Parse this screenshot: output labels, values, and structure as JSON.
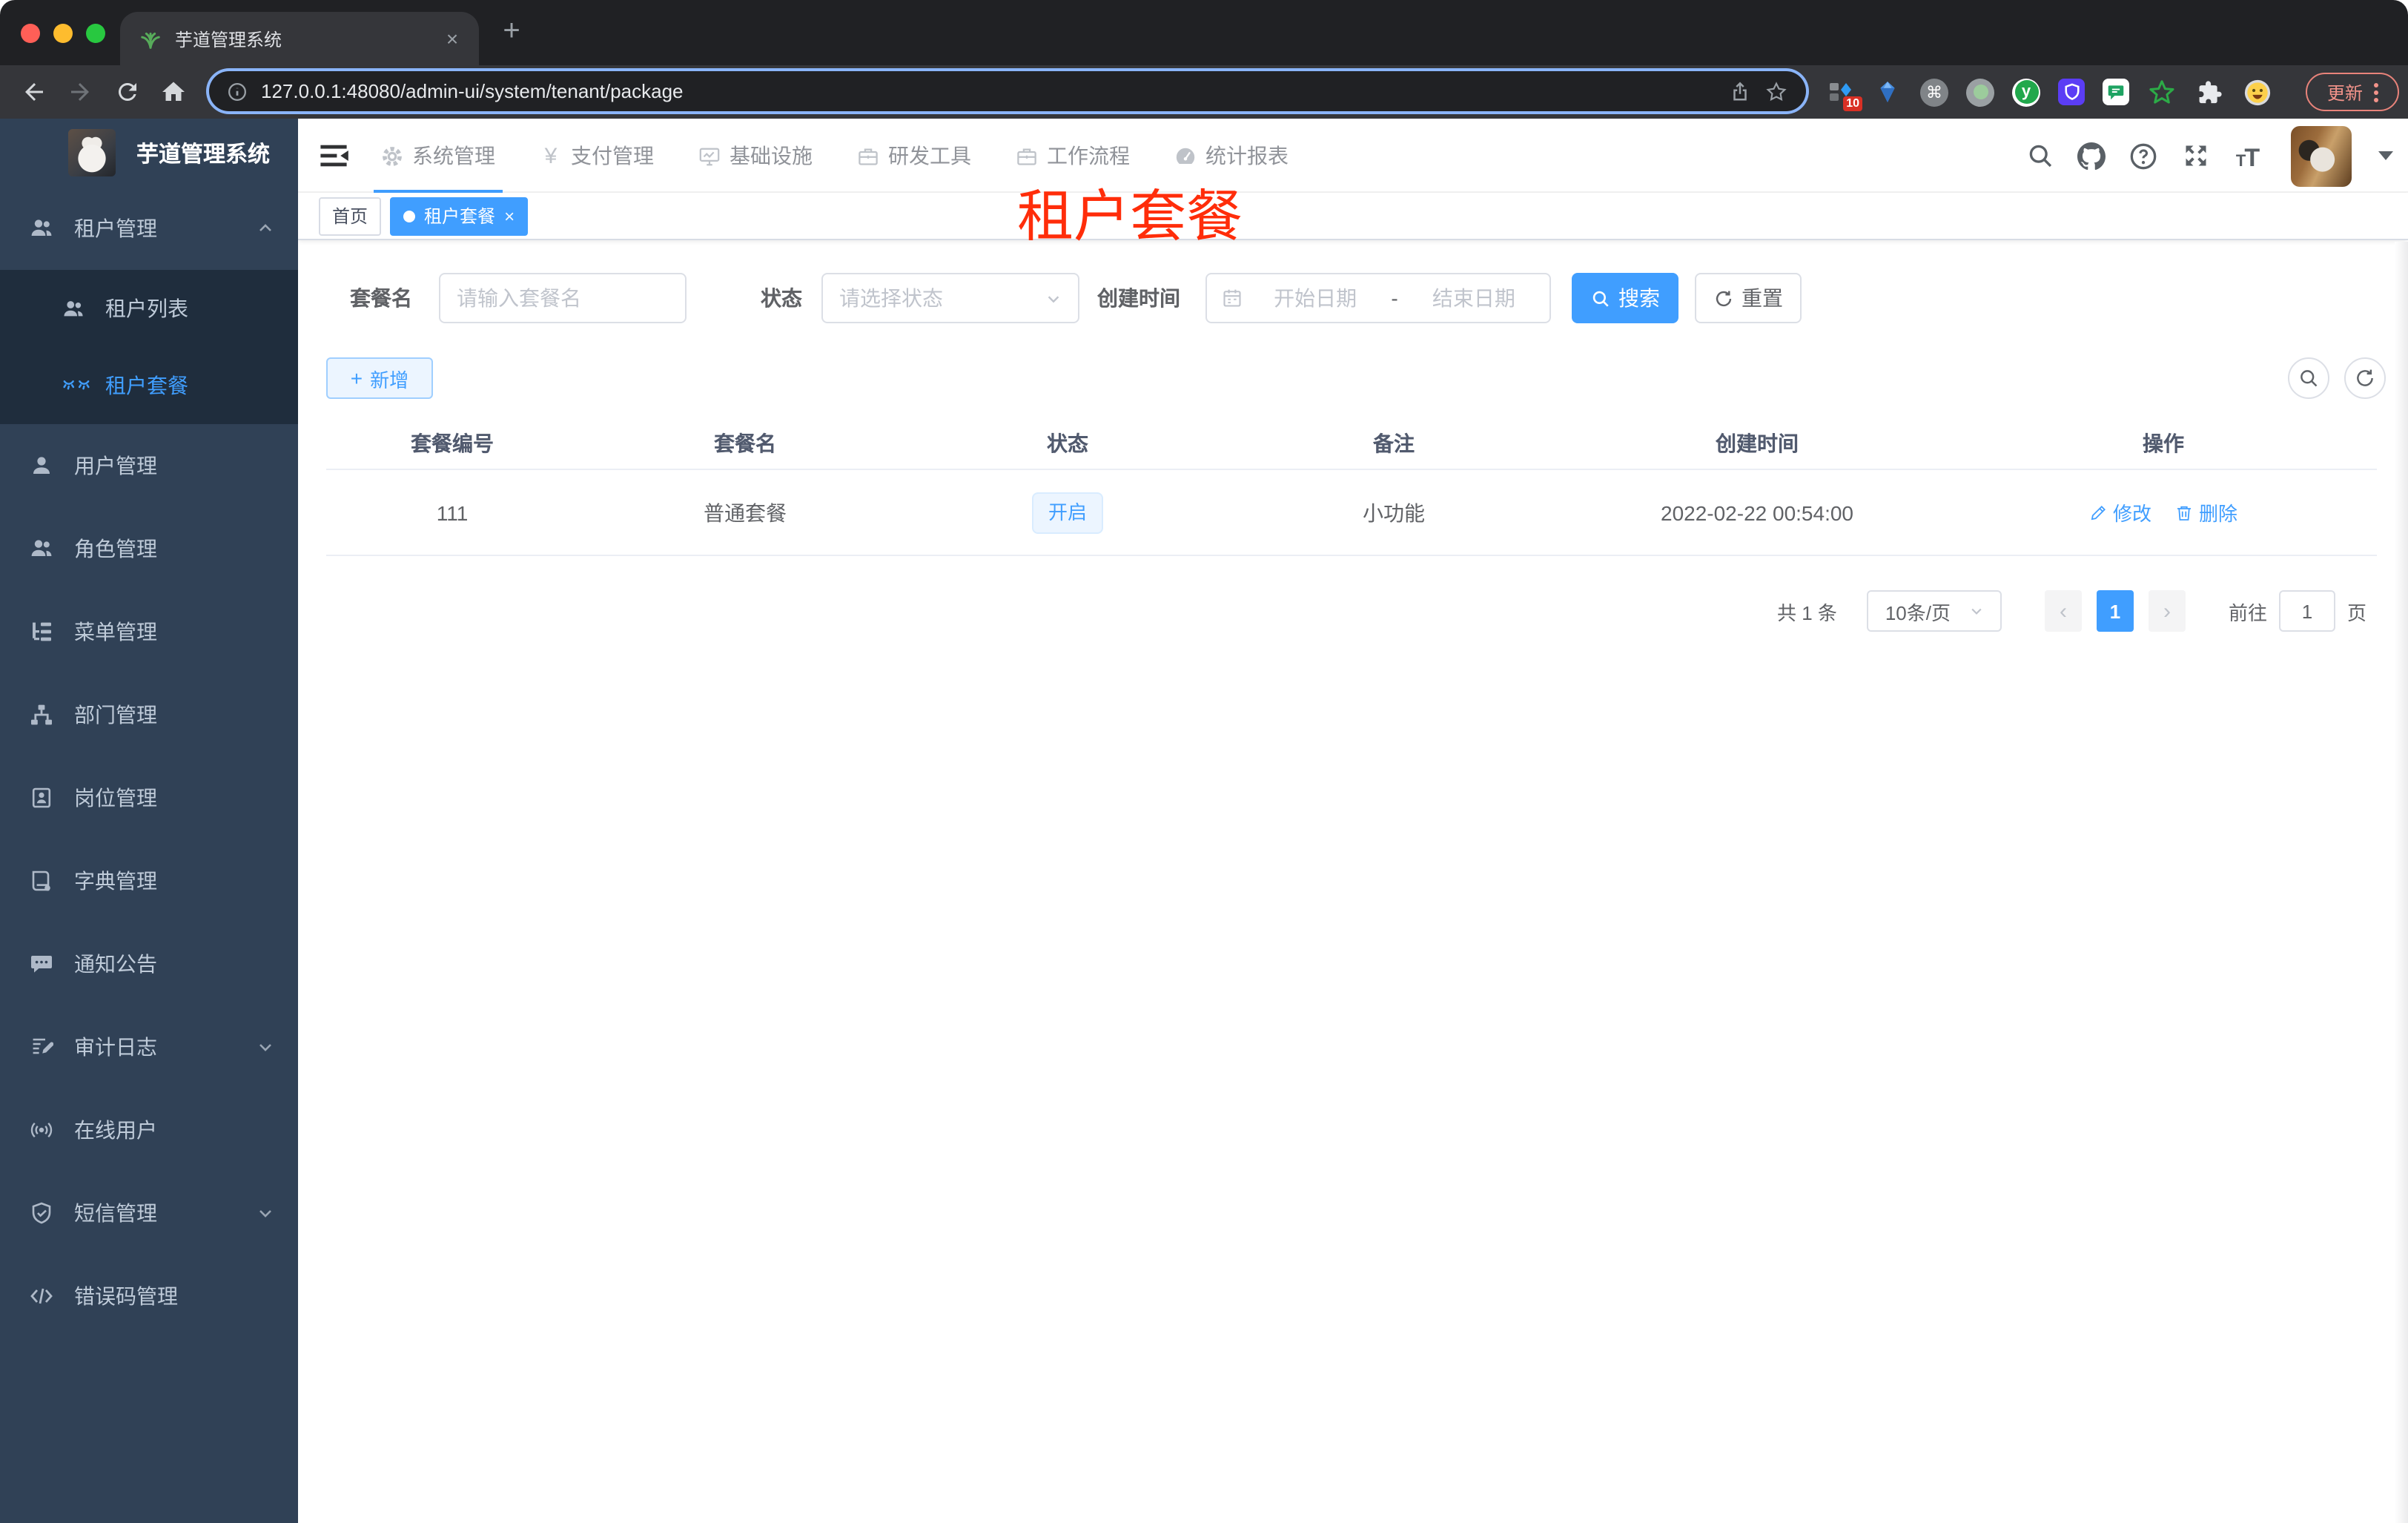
{
  "browser": {
    "tab_title": "芋道管理系统",
    "url": "127.0.0.1:48080/admin-ui/system/tenant/package",
    "extension_badge": "10",
    "update_label": "更新"
  },
  "icons": {
    "close": "×",
    "plus": "+",
    "yen": "¥",
    "cmd": "⌘",
    "ext_y": "y",
    "font_small": "T",
    "font_large": "T",
    "chevron_left": "‹",
    "chevron_right": "›"
  },
  "app": {
    "logo_title": "芋道管理系统",
    "topnav": [
      {
        "label": "系统管理",
        "active": true
      },
      {
        "label": "支付管理",
        "active": false
      },
      {
        "label": "基础设施",
        "active": false
      },
      {
        "label": "研发工具",
        "active": false
      },
      {
        "label": "工作流程",
        "active": false
      },
      {
        "label": "统计报表",
        "active": false
      }
    ],
    "sidebar": [
      {
        "label": "租户管理"
      },
      {
        "label": "租户列表"
      },
      {
        "label": "租户套餐",
        "active": true
      },
      {
        "label": "用户管理"
      },
      {
        "label": "角色管理"
      },
      {
        "label": "菜单管理"
      },
      {
        "label": "部门管理"
      },
      {
        "label": "岗位管理"
      },
      {
        "label": "字典管理"
      },
      {
        "label": "通知公告"
      },
      {
        "label": "审计日志"
      },
      {
        "label": "在线用户"
      },
      {
        "label": "短信管理"
      },
      {
        "label": "错误码管理"
      }
    ],
    "tags": {
      "home": "首页",
      "active": "租户套餐"
    },
    "overlay_title": "租户套餐",
    "filters": {
      "name_label": "套餐名",
      "name_placeholder": "请输入套餐名",
      "status_label": "状态",
      "status_placeholder": "请选择状态",
      "date_label": "创建时间",
      "date_start_placeholder": "开始日期",
      "date_separator": "-",
      "date_end_placeholder": "结束日期",
      "search_label": "搜索",
      "reset_label": "重置"
    },
    "toolbar": {
      "add_label": "新增"
    },
    "table": {
      "headers": [
        "套餐编号",
        "套餐名",
        "状态",
        "备注",
        "创建时间",
        "操作"
      ],
      "rows": [
        {
          "id": "111",
          "name": "普通套餐",
          "status": "开启",
          "remark": "小功能",
          "created": "2022-02-22 00:54:00",
          "edit_label": "修改",
          "delete_label": "删除"
        }
      ]
    },
    "pagination": {
      "total": "共 1 条",
      "page_size": "10条/页",
      "current": "1",
      "goto_label": "前往",
      "goto_value": "1",
      "unit_label": "页"
    }
  },
  "colors": {
    "accent": "#409eff",
    "overlay_red": "#ff2d0a",
    "sidebar_bg": "#304156",
    "submenu_bg": "#1f2d3d",
    "status_tag_bg": "#ecf5ff",
    "status_tag_border": "#d9ecff",
    "tag_active_bg": "#409eff",
    "update_salmon": "#f2938a",
    "chrome_frame": "#202124",
    "chrome_toolbar": "#35363a"
  }
}
